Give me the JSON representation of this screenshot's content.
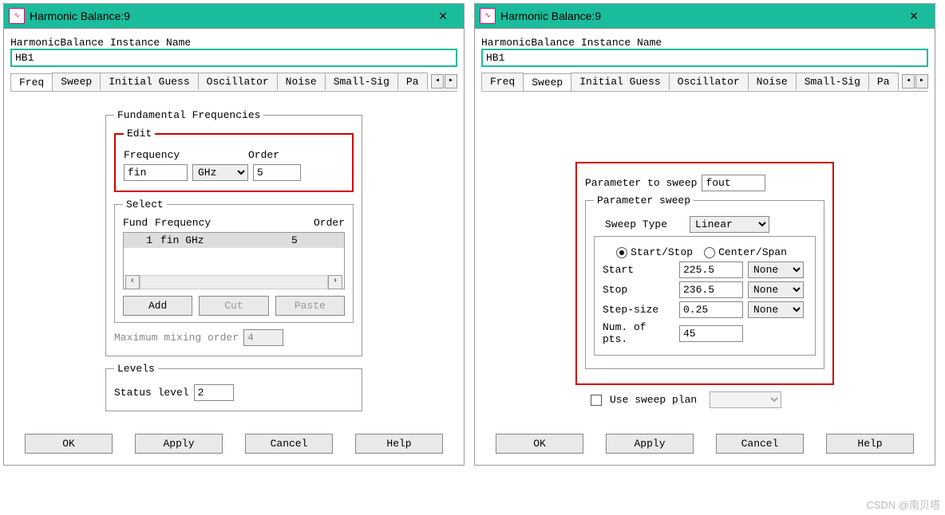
{
  "title": "Harmonic Balance:9",
  "instance_label": "HarmonicBalance Instance Name",
  "instance_value": "HB1",
  "tabs": [
    "Freq",
    "Sweep",
    "Initial Guess",
    "Oscillator",
    "Noise",
    "Small-Sig",
    "Pa"
  ],
  "freq": {
    "group": "Fundamental Frequencies",
    "edit": {
      "legend": "Edit",
      "freq_label": "Frequency",
      "order_label": "Order",
      "freq_value": "fin",
      "unit": "GHz",
      "order_value": "5"
    },
    "select": {
      "legend": "Select",
      "h_fund": "Fund",
      "h_freq": "Frequency",
      "h_order": "Order",
      "row_idx": "1",
      "row_freq": "fin GHz",
      "row_order": "5",
      "add": "Add",
      "cut": "Cut",
      "paste": "Paste"
    },
    "maxmix": {
      "label": "Maximum mixing order",
      "value": "4"
    },
    "levels": {
      "legend": "Levels",
      "label": "Status level",
      "value": "2"
    }
  },
  "sweep": {
    "param_label": "Parameter to sweep",
    "param_value": "fout",
    "group": "Parameter sweep",
    "sweep_type_label": "Sweep Type",
    "sweep_type_value": "Linear",
    "r1": "Start/Stop",
    "r2": "Center/Span",
    "start_l": "Start",
    "start_v": "225.5",
    "start_u": "None",
    "stop_l": "Stop",
    "stop_v": "236.5",
    "stop_u": "None",
    "step_l": "Step-size",
    "step_v": "0.25",
    "step_u": "None",
    "npts_l": "Num. of pts.",
    "npts_v": "45",
    "use_plan": "Use sweep plan"
  },
  "footer": {
    "ok": "OK",
    "apply": "Apply",
    "cancel": "Cancel",
    "help": "Help"
  },
  "watermark": "CSDN @南贝塔"
}
